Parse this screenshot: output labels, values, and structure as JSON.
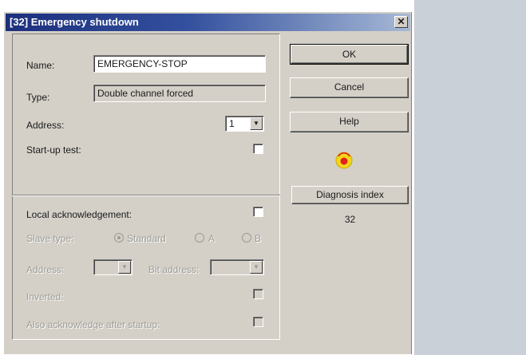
{
  "window": {
    "title": "[32] Emergency shutdown",
    "close_glyph": "✕"
  },
  "form": {
    "name_label": "Name:",
    "name_value": "EMERGENCY-STOP",
    "type_label": "Type:",
    "type_value": "Double channel forced",
    "address_label": "Address:",
    "address_value": "1",
    "startup_test_label": "Start-up test:",
    "startup_test_checked": false,
    "local_ack_label": "Local acknowledgement:",
    "local_ack_checked": false,
    "slave_type_label": "Slave type:",
    "slave_type_options": [
      "Standard",
      "A",
      "B"
    ],
    "slave_type_selected": "Standard",
    "address2_label": "Address:",
    "address2_value": "",
    "bit_address_label": "Bit address:",
    "bit_address_value": "",
    "inverted_label": "Inverted:",
    "inverted_checked": false,
    "also_ack_label": "Also acknowledge after startup:",
    "also_ack_checked": false
  },
  "buttons": {
    "ok": "OK",
    "cancel": "Cancel",
    "help": "Help",
    "diagnosis_index": "Diagnosis index"
  },
  "diagnosis": {
    "value": "32",
    "status_icon": "emergency-stop-icon"
  },
  "colors": {
    "titlebar_start": "#1c2f7c",
    "titlebar_end": "#a7b9d6",
    "dialog_bg": "#d4d0c8",
    "status_red": "#e0221b",
    "status_yellow": "#f4d51a"
  }
}
